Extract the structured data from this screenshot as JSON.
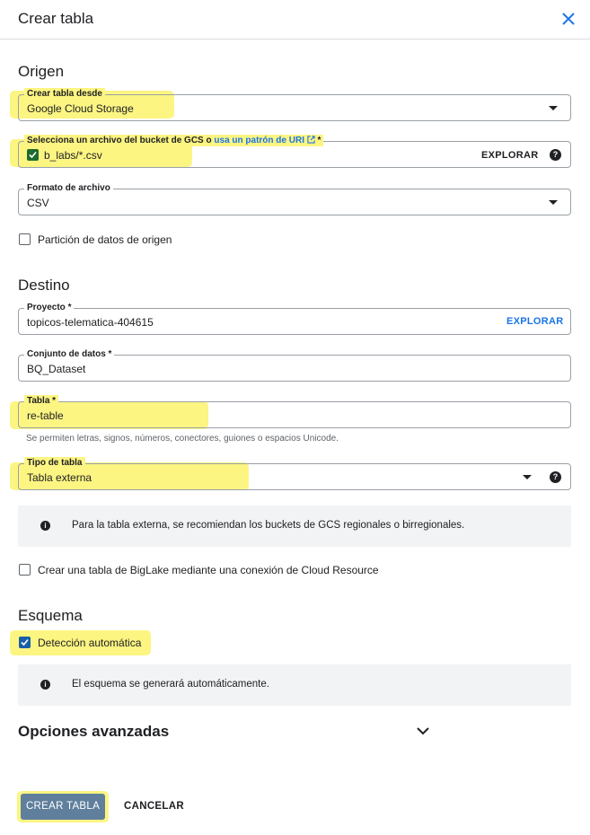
{
  "header": {
    "title": "Crear tabla",
    "close_icon": "close-icon"
  },
  "origen": {
    "section_title": "Origen",
    "crear_desde": {
      "label": "Crear tabla desde",
      "value": "Google Cloud Storage"
    },
    "gcs_file": {
      "label": "Selecciona un archivo del bucket de GCS o",
      "link": "usa un patrón de URI",
      "required": "*",
      "value": "b_labs/*.csv",
      "browse": "EXPLORAR"
    },
    "formato": {
      "label": "Formato de archivo",
      "value": "CSV"
    },
    "particion": {
      "label": "Partición de datos de origen",
      "checked": false
    }
  },
  "destino": {
    "section_title": "Destino",
    "proyecto": {
      "label": "Proyecto *",
      "value": "topicos-telematica-404615",
      "browse": "EXPLORAR"
    },
    "conjunto": {
      "label": "Conjunto de datos *",
      "value": "BQ_Dataset"
    },
    "tabla": {
      "label": "Tabla *",
      "value": "re-table",
      "hint": "Se permiten letras, signos, números, conectores, guiones o espacios Unicode."
    },
    "tipo": {
      "label": "Tipo de tabla",
      "value": "Tabla externa"
    },
    "info": "Para la tabla externa, se recomiendan los buckets de GCS regionales o birregionales.",
    "biglake": {
      "label": "Crear una tabla de BigLake mediante una conexión de Cloud Resource",
      "checked": false
    }
  },
  "esquema": {
    "section_title": "Esquema",
    "auto": {
      "label": "Detección automática",
      "checked": true
    },
    "info": "El esquema se generará automáticamente."
  },
  "avanzadas": {
    "title": "Opciones avanzadas"
  },
  "footer": {
    "create": "CREAR TABLA",
    "cancel": "CANCELAR"
  },
  "colors": {
    "accent": "#1a73e8",
    "highlight": "#fcf582",
    "primary_button": "#5f7f9c"
  }
}
